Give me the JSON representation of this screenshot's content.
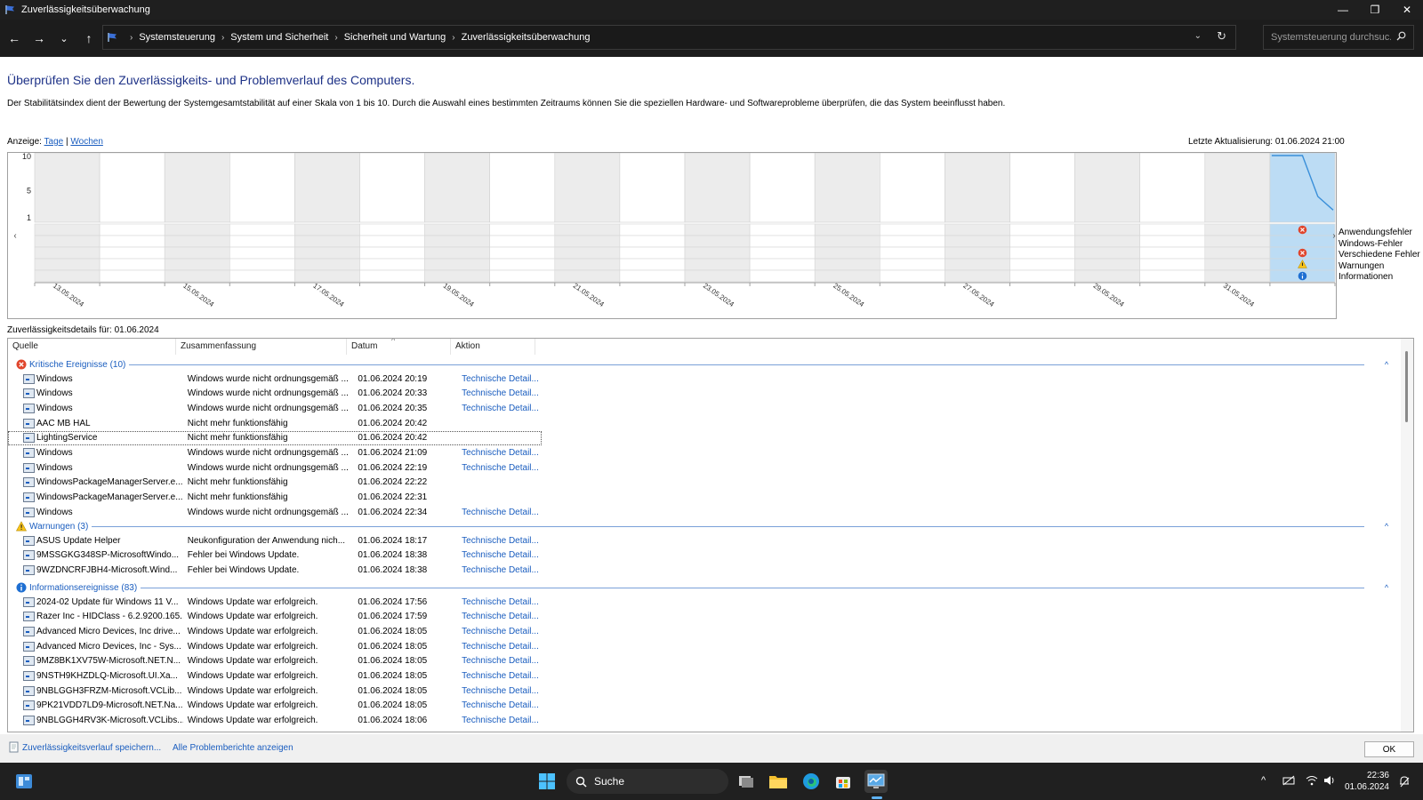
{
  "window": {
    "title": "Zuverlässigkeitsüberwachung",
    "controls": {
      "minimize": "—",
      "restore": "❐",
      "close": "✕"
    }
  },
  "nav": {
    "back": "←",
    "forward": "→",
    "recent": "⌄",
    "up": "↑",
    "breadcrumbs": [
      "Systemsteuerung",
      "System und Sicherheit",
      "Sicherheit und Wartung",
      "Zuverlässigkeitsüberwachung"
    ],
    "dropdown_glyph": "⌄",
    "refresh_glyph": "↻",
    "search_placeholder": "Systemsteuerung durchsuc..."
  },
  "page": {
    "title": "Überprüfen Sie den Zuverlässigkeits- und Problemverlauf des Computers.",
    "description": "Der Stabilitätsindex dient der Bewertung der Systemgesamtstabilität auf einer Skala von 1 bis 10. Durch die Auswahl eines bestimmten Zeitraums können Sie die speziellen Hardware- und Softwareprobleme überprüfen, die das System beeinflusst haben.",
    "view_prefix": "Anzeige:",
    "view_days": "Tage",
    "view_sep": "|",
    "view_weeks": "Wochen",
    "last_update": "Letzte Aktualisierung: 01.06.2024 21:00"
  },
  "chart_data": {
    "type": "line",
    "yticks": [
      "10",
      "5",
      "1"
    ],
    "ylim": [
      1,
      10
    ],
    "x_labels": [
      "13.05.2024",
      "15.05.2024",
      "17.05.2024",
      "19.05.2024",
      "21.05.2024",
      "23.05.2024",
      "25.05.2024",
      "27.05.2024",
      "29.05.2024",
      "31.05.2024"
    ],
    "columns": 20,
    "selected_day": "01.06.2024",
    "stability_series": [
      {
        "day": "01.06.2024",
        "points": [
          10,
          10,
          10,
          4,
          2
        ]
      }
    ],
    "legend": [
      "Anwendungsfehler",
      "Windows-Fehler",
      "Verschiedene Fehler",
      "Warnungen",
      "Informationen"
    ],
    "events_on_selected_day": {
      "Anwendungsfehler": "error",
      "Windows-Fehler": "",
      "Verschiedene Fehler": "error",
      "Warnungen": "warning",
      "Informationen": "info"
    },
    "colors": {
      "selected": "#bcdcf4",
      "line": "#3a8fd9",
      "shade": "#ececec"
    },
    "nav_left": "‹",
    "nav_right": "›"
  },
  "details": {
    "label": "Zuverlässigkeitsdetails für: 01.06.2024",
    "columns": [
      "Quelle",
      "Zusammenfassung",
      "Datum",
      "Aktion"
    ],
    "sort_glyph": "^",
    "collapse_glyph": "^",
    "groups": [
      {
        "title": "Kritische Ereignisse (10)",
        "icon": "error",
        "rows": [
          {
            "source": "Windows",
            "summary": "Windows wurde nicht ordnungsgemäß ...",
            "date": "01.06.2024 20:19",
            "action": "Technische Detail..."
          },
          {
            "source": "Windows",
            "summary": "Windows wurde nicht ordnungsgemäß ...",
            "date": "01.06.2024 20:33",
            "action": "Technische Detail..."
          },
          {
            "source": "Windows",
            "summary": "Windows wurde nicht ordnungsgemäß ...",
            "date": "01.06.2024 20:35",
            "action": "Technische Detail..."
          },
          {
            "source": "AAC MB HAL",
            "summary": "Nicht mehr funktionsfähig",
            "date": "01.06.2024 20:42",
            "action": ""
          },
          {
            "source": "LightingService",
            "summary": "Nicht mehr funktionsfähig",
            "date": "01.06.2024 20:42",
            "action": "",
            "selected": true
          },
          {
            "source": "Windows",
            "summary": "Windows wurde nicht ordnungsgemäß ...",
            "date": "01.06.2024 21:09",
            "action": "Technische Detail..."
          },
          {
            "source": "Windows",
            "summary": "Windows wurde nicht ordnungsgemäß ...",
            "date": "01.06.2024 22:19",
            "action": "Technische Detail..."
          },
          {
            "source": "WindowsPackageManagerServer.e...",
            "summary": "Nicht mehr funktionsfähig",
            "date": "01.06.2024 22:22",
            "action": ""
          },
          {
            "source": "WindowsPackageManagerServer.e...",
            "summary": "Nicht mehr funktionsfähig",
            "date": "01.06.2024 22:31",
            "action": ""
          },
          {
            "source": "Windows",
            "summary": "Windows wurde nicht ordnungsgemäß ...",
            "date": "01.06.2024 22:34",
            "action": "Technische Detail..."
          }
        ]
      },
      {
        "title": "Warnungen (3)",
        "icon": "warning",
        "rows": [
          {
            "source": "ASUS Update Helper",
            "summary": "Neukonfiguration der Anwendung nich...",
            "date": "01.06.2024 18:17",
            "action": "Technische Detail..."
          },
          {
            "source": "9MSSGKG348SP-MicrosoftWindo...",
            "summary": "Fehler bei Windows Update.",
            "date": "01.06.2024 18:38",
            "action": "Technische Detail..."
          },
          {
            "source": "9WZDNCRFJBH4-Microsoft.Wind...",
            "summary": "Fehler bei Windows Update.",
            "date": "01.06.2024 18:38",
            "action": "Technische Detail..."
          }
        ]
      },
      {
        "title": "Informationsereignisse (83)",
        "icon": "info",
        "rows": [
          {
            "source": "2024-02 Update für Windows 11 V...",
            "summary": "Windows Update war erfolgreich.",
            "date": "01.06.2024 17:56",
            "action": "Technische Detail..."
          },
          {
            "source": "Razer Inc - HIDClass - 6.2.9200.165...",
            "summary": "Windows Update war erfolgreich.",
            "date": "01.06.2024 17:59",
            "action": "Technische Detail..."
          },
          {
            "source": "Advanced Micro Devices, Inc drive...",
            "summary": "Windows Update war erfolgreich.",
            "date": "01.06.2024 18:05",
            "action": "Technische Detail..."
          },
          {
            "source": "Advanced Micro Devices, Inc - Sys...",
            "summary": "Windows Update war erfolgreich.",
            "date": "01.06.2024 18:05",
            "action": "Technische Detail..."
          },
          {
            "source": "9MZ8BK1XV75W-Microsoft.NET.N...",
            "summary": "Windows Update war erfolgreich.",
            "date": "01.06.2024 18:05",
            "action": "Technische Detail..."
          },
          {
            "source": "9NSTH9KHZDLQ-Microsoft.UI.Xa...",
            "summary": "Windows Update war erfolgreich.",
            "date": "01.06.2024 18:05",
            "action": "Technische Detail..."
          },
          {
            "source": "9NBLGGH3FRZM-Microsoft.VCLib...",
            "summary": "Windows Update war erfolgreich.",
            "date": "01.06.2024 18:05",
            "action": "Technische Detail..."
          },
          {
            "source": "9PK21VDD7LD9-Microsoft.NET.Na...",
            "summary": "Windows Update war erfolgreich.",
            "date": "01.06.2024 18:05",
            "action": "Technische Detail..."
          },
          {
            "source": "9NBLGGH4RV3K-Microsoft.VCLibs...",
            "summary": "Windows Update war erfolgreich.",
            "date": "01.06.2024 18:06",
            "action": "Technische Detail..."
          }
        ]
      }
    ]
  },
  "bottom": {
    "save_link": "Zuverlässigkeitsverlauf speichern...",
    "reports_link": "Alle Problemberichte anzeigen",
    "ok": "OK"
  },
  "taskbar": {
    "search_label": "Suche",
    "time": "22:36",
    "date": "01.06.2024"
  }
}
